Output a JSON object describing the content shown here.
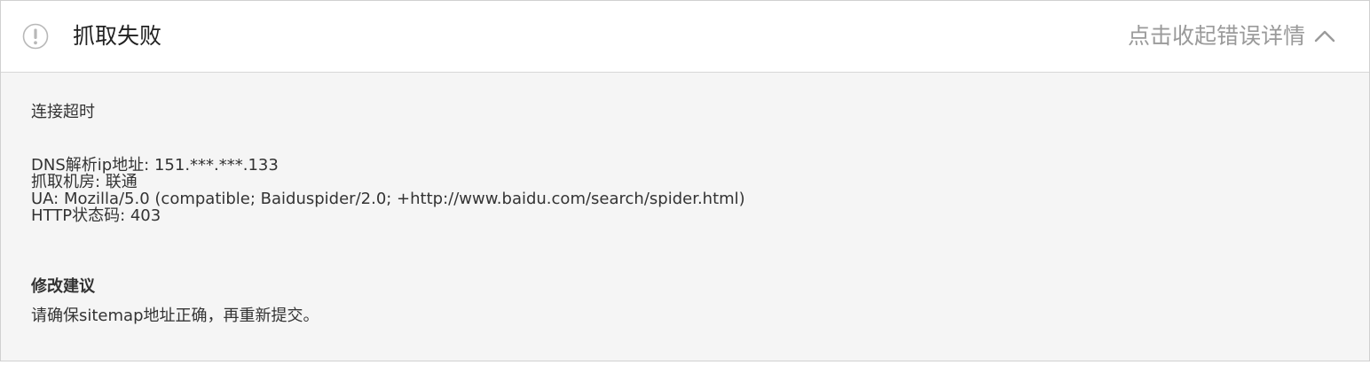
{
  "header": {
    "icon": "warning-circle-icon",
    "title": "抓取失败",
    "toggle_label": "点击收起错误详情",
    "toggle_icon": "chevron-up-icon"
  },
  "details": {
    "status": "连接超时",
    "dns_line": "DNS解析ip地址: 151.***.***.133",
    "room_line": "抓取机房: 联通",
    "ua_line": "UA: Mozilla/5.0 (compatible; Baiduspider/2.0; +http://www.baidu.com/search/spider.html)",
    "http_line": "HTTP状态码: 403"
  },
  "suggestion": {
    "title": "修改建议",
    "text": "请确保sitemap地址正确，再重新提交。"
  },
  "colors": {
    "border": "#d0d0d0",
    "body_bg": "#f5f5f5",
    "muted_text": "#9a9a9a",
    "main_text": "#333333"
  }
}
